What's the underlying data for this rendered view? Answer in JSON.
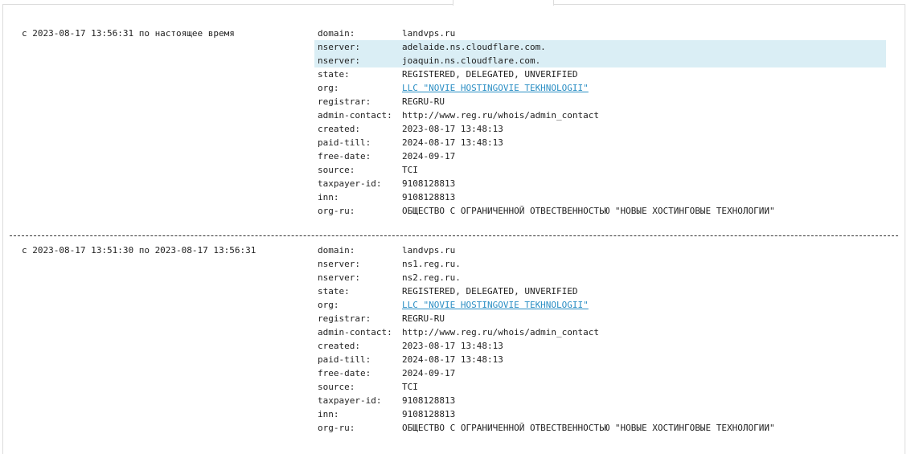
{
  "records": [
    {
      "period": "с 2023-08-17 13:56:31 по настоящее время",
      "rows": [
        {
          "key": "domain:",
          "value": "landvps.ru",
          "link": false,
          "highlight": false
        },
        {
          "key": "nserver:",
          "value": "adelaide.ns.cloudflare.com.",
          "link": false,
          "highlight": true
        },
        {
          "key": "nserver:",
          "value": "joaquin.ns.cloudflare.com.",
          "link": false,
          "highlight": true
        },
        {
          "key": "state:",
          "value": "REGISTERED, DELEGATED, UNVERIFIED",
          "link": false,
          "highlight": false
        },
        {
          "key": "org:",
          "value": "LLC \"NOVIE HOSTINGOVIE TEKHNOLOGII\"",
          "link": true,
          "highlight": false
        },
        {
          "key": "registrar:",
          "value": "REGRU-RU",
          "link": false,
          "highlight": false
        },
        {
          "key": "admin-contact:",
          "value": "http://www.reg.ru/whois/admin_contact",
          "link": false,
          "highlight": false
        },
        {
          "key": "created:",
          "value": "2023-08-17 13:48:13",
          "link": false,
          "highlight": false
        },
        {
          "key": "paid-till:",
          "value": "2024-08-17 13:48:13",
          "link": false,
          "highlight": false
        },
        {
          "key": "free-date:",
          "value": "2024-09-17",
          "link": false,
          "highlight": false
        },
        {
          "key": "source:",
          "value": "TCI",
          "link": false,
          "highlight": false
        },
        {
          "key": "taxpayer-id:",
          "value": "9108128813",
          "link": false,
          "highlight": false
        },
        {
          "key": "inn:",
          "value": "9108128813",
          "link": false,
          "highlight": false
        },
        {
          "key": "org-ru:",
          "value": "ОБЩЕСТВО С ОГРАНИЧЕННОЙ ОТВЕСТВЕННОСТЬЮ \"НОВЫЕ ХОСТИНГОВЫЕ ТЕХНОЛОГИИ\"",
          "link": false,
          "highlight": false
        }
      ]
    },
    {
      "period": "с 2023-08-17 13:51:30 по 2023-08-17 13:56:31",
      "rows": [
        {
          "key": "domain:",
          "value": "landvps.ru",
          "link": false,
          "highlight": false
        },
        {
          "key": "nserver:",
          "value": "ns1.reg.ru.",
          "link": false,
          "highlight": false
        },
        {
          "key": "nserver:",
          "value": "ns2.reg.ru.",
          "link": false,
          "highlight": false
        },
        {
          "key": "state:",
          "value": "REGISTERED, DELEGATED, UNVERIFIED",
          "link": false,
          "highlight": false
        },
        {
          "key": "org:",
          "value": "LLC \"NOVIE HOSTINGOVIE TEKHNOLOGII\"",
          "link": true,
          "highlight": false
        },
        {
          "key": "registrar:",
          "value": "REGRU-RU",
          "link": false,
          "highlight": false
        },
        {
          "key": "admin-contact:",
          "value": "http://www.reg.ru/whois/admin_contact",
          "link": false,
          "highlight": false
        },
        {
          "key": "created:",
          "value": "2023-08-17 13:48:13",
          "link": false,
          "highlight": false
        },
        {
          "key": "paid-till:",
          "value": "2024-08-17 13:48:13",
          "link": false,
          "highlight": false
        },
        {
          "key": "free-date:",
          "value": "2024-09-17",
          "link": false,
          "highlight": false
        },
        {
          "key": "source:",
          "value": "TCI",
          "link": false,
          "highlight": false
        },
        {
          "key": "taxpayer-id:",
          "value": "9108128813",
          "link": false,
          "highlight": false
        },
        {
          "key": "inn:",
          "value": "9108128813",
          "link": false,
          "highlight": false
        },
        {
          "key": "org-ru:",
          "value": "ОБЩЕСТВО С ОГРАНИЧЕННОЙ ОТВЕСТВЕННОСТЬЮ \"НОВЫЕ ХОСТИНГОВЫЕ ТЕХНОЛОГИИ\"",
          "link": false,
          "highlight": false
        }
      ]
    }
  ],
  "colors": {
    "highlight": "#daeef5",
    "link": "#2a8ec4",
    "text": "#222222"
  }
}
